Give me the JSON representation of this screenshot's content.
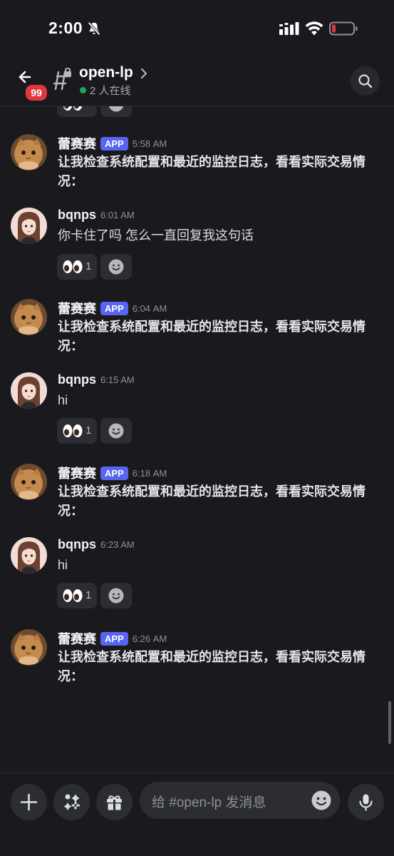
{
  "status_bar": {
    "time": "2:00"
  },
  "header": {
    "unread_count": "99",
    "channel_name": "open-lp",
    "online_text": "2 人在线"
  },
  "messages": [
    {
      "username": "蕾赛赛",
      "tag": "APP",
      "time": "5:58 AM",
      "text": "让我检查系统配置和最近的监控日志，看看实际交易情况："
    },
    {
      "username": "bqnps",
      "time": "6:01 AM",
      "text": "你卡住了吗 怎么一直回复我这句话",
      "reaction_count": "1"
    },
    {
      "username": "蕾赛赛",
      "tag": "APP",
      "time": "6:04 AM",
      "text": "让我检查系统配置和最近的监控日志，看看实际交易情况："
    },
    {
      "username": "bqnps",
      "time": "6:15 AM",
      "text": "hi",
      "reaction_count": "1"
    },
    {
      "username": "蕾赛赛",
      "tag": "APP",
      "time": "6:18 AM",
      "text": "让我检查系统配置和最近的监控日志，看看实际交易情况："
    },
    {
      "username": "bqnps",
      "time": "6:23 AM",
      "text": "hi",
      "reaction_count": "1"
    },
    {
      "username": "蕾赛赛",
      "tag": "APP",
      "time": "6:26 AM",
      "text": "让我检查系统配置和最近的监控日志，看看实际交易情况："
    }
  ],
  "composer": {
    "placeholder": "给 #open-lp 发消息"
  },
  "icons": {
    "reaction_emoji": "eyes-icon",
    "add_reaction": "smile-plus-icon"
  },
  "colors": {
    "background": "#1a1a1e",
    "accent": "#5865f2",
    "badge": "#e0383f",
    "online": "#23a55a"
  }
}
